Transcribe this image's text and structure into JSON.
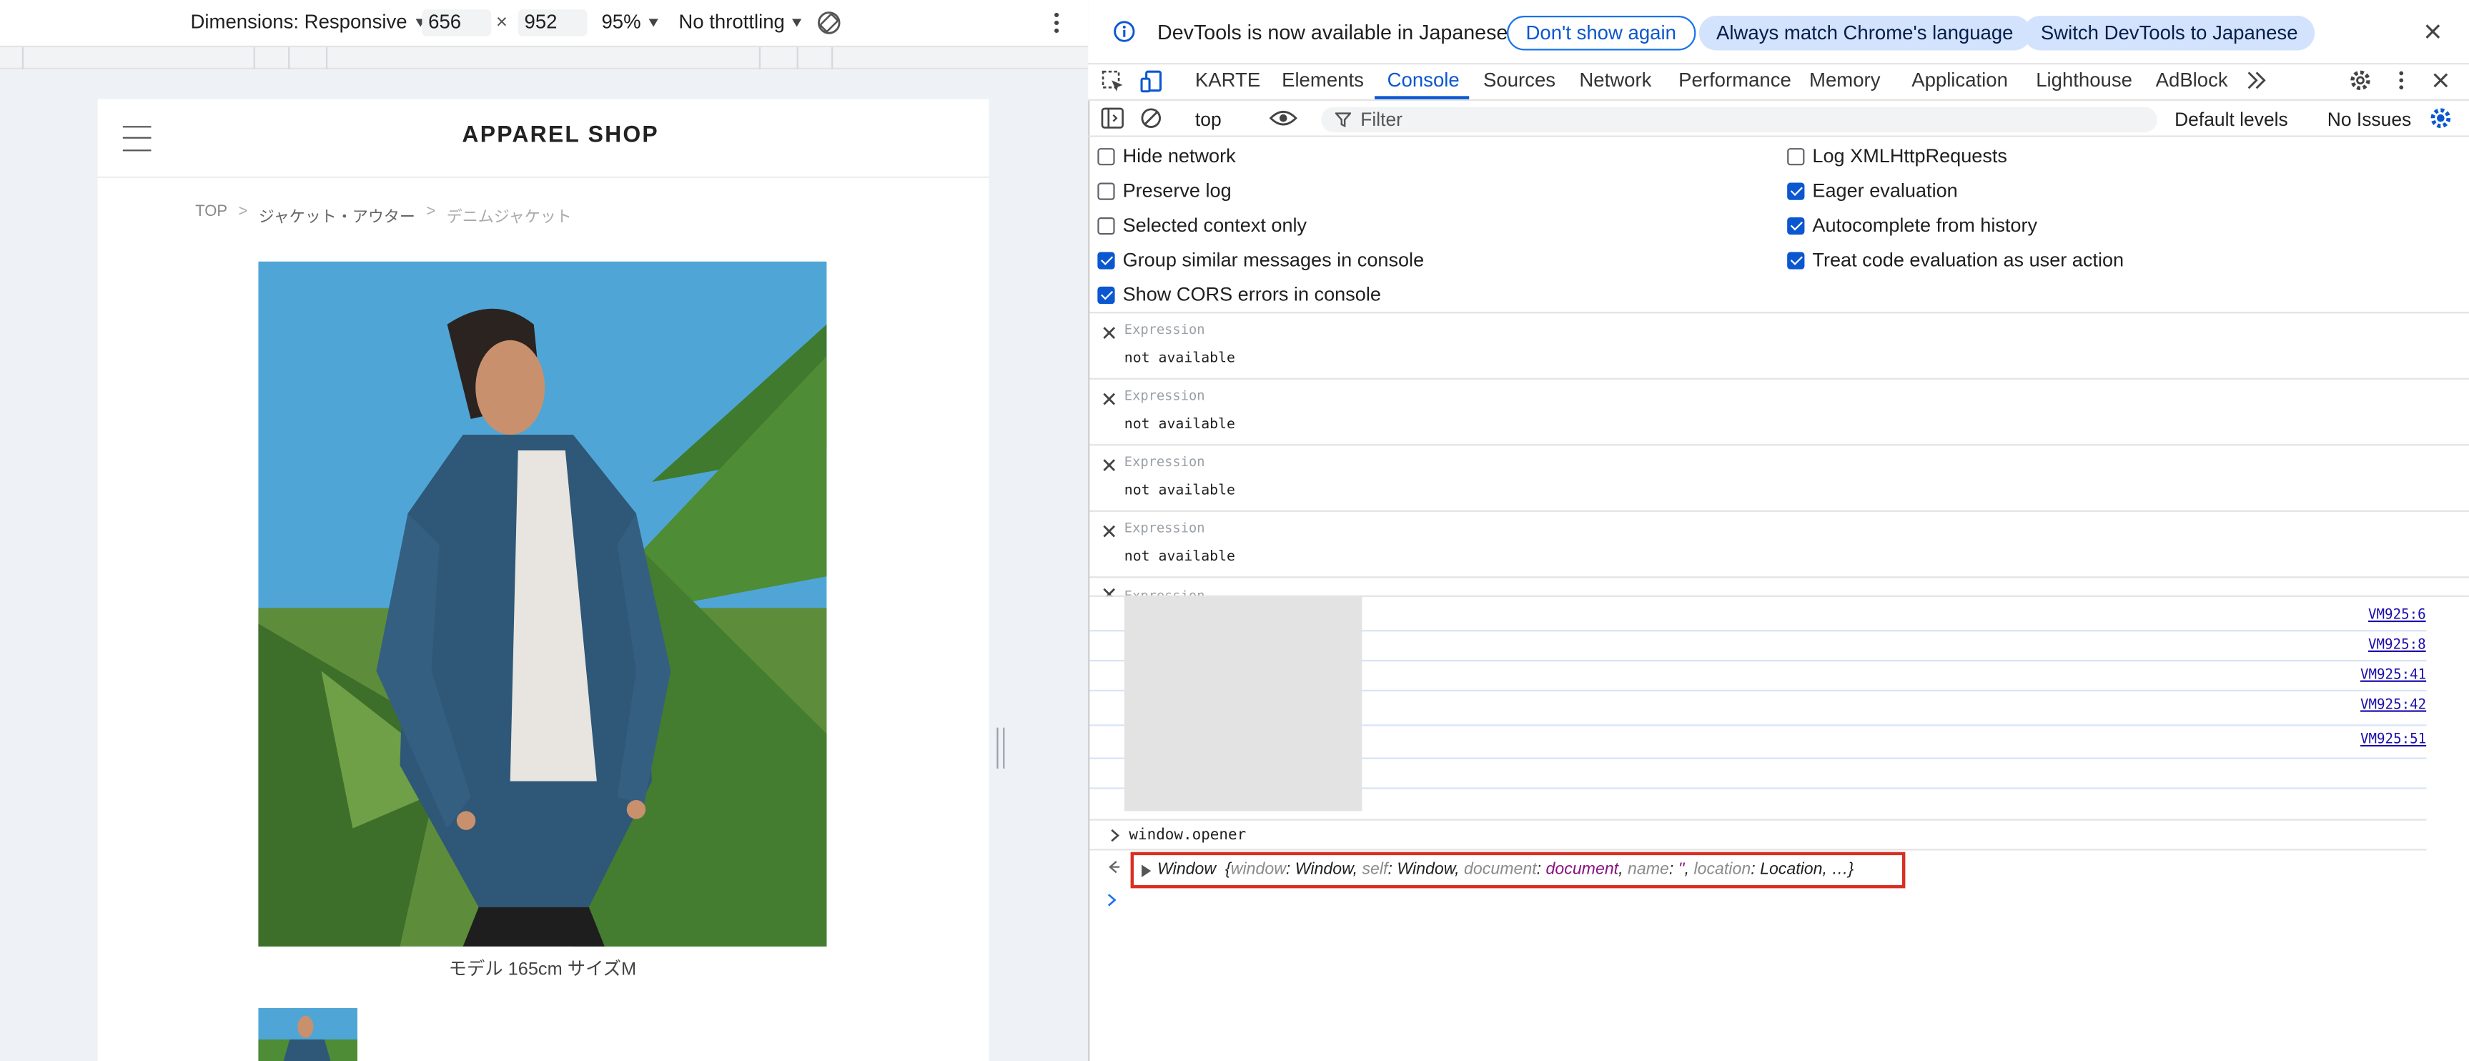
{
  "device_toolbar": {
    "dimensions_label": "Dimensions: Responsive",
    "width": "656",
    "times": "×",
    "height": "952",
    "zoom": "95%",
    "throttling": "No throttling"
  },
  "site": {
    "title": "APPAREL SHOP",
    "breadcrumb": [
      "TOP",
      "ジャケット・アウター",
      "デニムジャケット"
    ],
    "breadcrumb_separator": ">",
    "caption": "モデル 165cm サイズM"
  },
  "infobar": {
    "message": "DevTools is now available in Japanese",
    "dont_show": "Don't show again",
    "match_language": "Always match Chrome's language",
    "switch_japanese": "Switch DevTools to Japanese"
  },
  "tabs": [
    "KARTE",
    "Elements",
    "Console",
    "Sources",
    "Network",
    "Performance",
    "Memory",
    "Application",
    "Lighthouse",
    "AdBlock"
  ],
  "selected_tab": "Console",
  "console_toolbar": {
    "context": "top",
    "filter_placeholder": "Filter",
    "levels": "Default levels",
    "issues": "No Issues"
  },
  "settings": {
    "left": [
      {
        "label": "Hide network",
        "checked": false
      },
      {
        "label": "Preserve log",
        "checked": false
      },
      {
        "label": "Selected context only",
        "checked": false
      },
      {
        "label": "Group similar messages in console",
        "checked": true
      },
      {
        "label": "Show CORS errors in console",
        "checked": true
      }
    ],
    "right": [
      {
        "label": "Log XMLHttpRequests",
        "checked": false
      },
      {
        "label": "Eager evaluation",
        "checked": true
      },
      {
        "label": "Autocomplete from history",
        "checked": true
      },
      {
        "label": "Treat code evaluation as user action",
        "checked": true
      }
    ]
  },
  "expressions": [
    {
      "label": "Expression",
      "value": "not available"
    },
    {
      "label": "Expression",
      "value": "not available"
    },
    {
      "label": "Expression",
      "value": "not available"
    },
    {
      "label": "Expression",
      "value": "not available"
    }
  ],
  "expression_cut_label": "Expression",
  "log_sources": [
    "VM925:6",
    "VM925:8",
    "VM925:41",
    "VM925:42",
    "VM925:51"
  ],
  "console_input": "window.opener",
  "console_result": {
    "type": "Window",
    "open_brace": "{",
    "k1": "window",
    "v1": "Window",
    "k2": "self",
    "v2": "Window",
    "k3": "document",
    "v3": "document",
    "k4": "name",
    "v4": "''",
    "k5": "location",
    "v5": "Location",
    "ellipsis": "…}"
  },
  "colors": {
    "accent": "#0b57d0",
    "highlight_border": "#d93025"
  }
}
